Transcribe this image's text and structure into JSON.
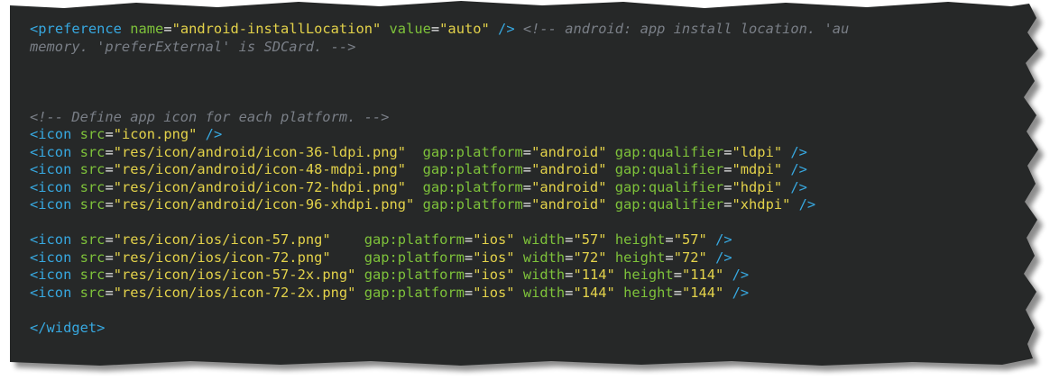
{
  "theme": {
    "background": "#262828",
    "tag": "#37a8e0",
    "attr": "#7ec23a",
    "string": "#e3d24a",
    "comment": "#7a7f87",
    "punct": "#3aa7e0"
  },
  "editor": {
    "lines": [
      [
        {
          "t": "<",
          "k": "tag"
        },
        {
          "t": "preference",
          "k": "tag"
        },
        {
          "t": " ",
          "k": "plain"
        },
        {
          "t": "name",
          "k": "attr"
        },
        {
          "t": "=",
          "k": "plain"
        },
        {
          "t": "\"android-installLocation\"",
          "k": "string"
        },
        {
          "t": " ",
          "k": "plain"
        },
        {
          "t": "value",
          "k": "attr"
        },
        {
          "t": "=",
          "k": "plain"
        },
        {
          "t": "\"auto\"",
          "k": "string"
        },
        {
          "t": " ",
          "k": "plain"
        },
        {
          "t": "/>",
          "k": "tag"
        },
        {
          "t": " ",
          "k": "plain"
        },
        {
          "t": "<!-- android: app install location. 'au",
          "k": "comment"
        }
      ],
      [
        {
          "t": "memory. 'preferExternal' is SDCard. -->",
          "k": "comment"
        }
      ],
      [],
      [],
      [],
      [
        {
          "t": "<!-- Define app icon for each platform. -->",
          "k": "comment"
        }
      ],
      [
        {
          "t": "<icon",
          "k": "tag"
        },
        {
          "t": " ",
          "k": "plain"
        },
        {
          "t": "src",
          "k": "attr"
        },
        {
          "t": "=",
          "k": "plain"
        },
        {
          "t": "\"icon.png\"",
          "k": "string"
        },
        {
          "t": " ",
          "k": "plain"
        },
        {
          "t": "/>",
          "k": "tag"
        }
      ],
      [
        {
          "t": "<icon",
          "k": "tag"
        },
        {
          "t": " ",
          "k": "plain"
        },
        {
          "t": "src",
          "k": "attr"
        },
        {
          "t": "=",
          "k": "plain"
        },
        {
          "t": "\"res/icon/android/icon-36-ldpi.png\"",
          "k": "string"
        },
        {
          "t": "  ",
          "k": "plain"
        },
        {
          "t": "gap:platform",
          "k": "attr"
        },
        {
          "t": "=",
          "k": "plain"
        },
        {
          "t": "\"android\"",
          "k": "string"
        },
        {
          "t": " ",
          "k": "plain"
        },
        {
          "t": "gap:qualifier",
          "k": "attr"
        },
        {
          "t": "=",
          "k": "plain"
        },
        {
          "t": "\"ldpi\"",
          "k": "string"
        },
        {
          "t": " ",
          "k": "plain"
        },
        {
          "t": "/>",
          "k": "tag"
        }
      ],
      [
        {
          "t": "<icon",
          "k": "tag"
        },
        {
          "t": " ",
          "k": "plain"
        },
        {
          "t": "src",
          "k": "attr"
        },
        {
          "t": "=",
          "k": "plain"
        },
        {
          "t": "\"res/icon/android/icon-48-mdpi.png\"",
          "k": "string"
        },
        {
          "t": "  ",
          "k": "plain"
        },
        {
          "t": "gap:platform",
          "k": "attr"
        },
        {
          "t": "=",
          "k": "plain"
        },
        {
          "t": "\"android\"",
          "k": "string"
        },
        {
          "t": " ",
          "k": "plain"
        },
        {
          "t": "gap:qualifier",
          "k": "attr"
        },
        {
          "t": "=",
          "k": "plain"
        },
        {
          "t": "\"mdpi\"",
          "k": "string"
        },
        {
          "t": " ",
          "k": "plain"
        },
        {
          "t": "/>",
          "k": "tag"
        }
      ],
      [
        {
          "t": "<icon",
          "k": "tag"
        },
        {
          "t": " ",
          "k": "plain"
        },
        {
          "t": "src",
          "k": "attr"
        },
        {
          "t": "=",
          "k": "plain"
        },
        {
          "t": "\"res/icon/android/icon-72-hdpi.png\"",
          "k": "string"
        },
        {
          "t": "  ",
          "k": "plain"
        },
        {
          "t": "gap:platform",
          "k": "attr"
        },
        {
          "t": "=",
          "k": "plain"
        },
        {
          "t": "\"android\"",
          "k": "string"
        },
        {
          "t": " ",
          "k": "plain"
        },
        {
          "t": "gap:qualifier",
          "k": "attr"
        },
        {
          "t": "=",
          "k": "plain"
        },
        {
          "t": "\"hdpi\"",
          "k": "string"
        },
        {
          "t": " ",
          "k": "plain"
        },
        {
          "t": "/>",
          "k": "tag"
        }
      ],
      [
        {
          "t": "<icon",
          "k": "tag"
        },
        {
          "t": " ",
          "k": "plain"
        },
        {
          "t": "src",
          "k": "attr"
        },
        {
          "t": "=",
          "k": "plain"
        },
        {
          "t": "\"res/icon/android/icon-96-xhdpi.png\"",
          "k": "string"
        },
        {
          "t": " ",
          "k": "plain"
        },
        {
          "t": "gap:platform",
          "k": "attr"
        },
        {
          "t": "=",
          "k": "plain"
        },
        {
          "t": "\"android\"",
          "k": "string"
        },
        {
          "t": " ",
          "k": "plain"
        },
        {
          "t": "gap:qualifier",
          "k": "attr"
        },
        {
          "t": "=",
          "k": "plain"
        },
        {
          "t": "\"xhdpi\"",
          "k": "string"
        },
        {
          "t": " ",
          "k": "plain"
        },
        {
          "t": "/>",
          "k": "tag"
        }
      ],
      [],
      [
        {
          "t": "<icon",
          "k": "tag"
        },
        {
          "t": " ",
          "k": "plain"
        },
        {
          "t": "src",
          "k": "attr"
        },
        {
          "t": "=",
          "k": "plain"
        },
        {
          "t": "\"res/icon/ios/icon-57.png\"",
          "k": "string"
        },
        {
          "t": "    ",
          "k": "plain"
        },
        {
          "t": "gap:platform",
          "k": "attr"
        },
        {
          "t": "=",
          "k": "plain"
        },
        {
          "t": "\"ios\"",
          "k": "string"
        },
        {
          "t": " ",
          "k": "plain"
        },
        {
          "t": "width",
          "k": "attr"
        },
        {
          "t": "=",
          "k": "plain"
        },
        {
          "t": "\"57\"",
          "k": "string"
        },
        {
          "t": " ",
          "k": "plain"
        },
        {
          "t": "height",
          "k": "attr"
        },
        {
          "t": "=",
          "k": "plain"
        },
        {
          "t": "\"57\"",
          "k": "string"
        },
        {
          "t": " ",
          "k": "plain"
        },
        {
          "t": "/>",
          "k": "tag"
        }
      ],
      [
        {
          "t": "<icon",
          "k": "tag"
        },
        {
          "t": " ",
          "k": "plain"
        },
        {
          "t": "src",
          "k": "attr"
        },
        {
          "t": "=",
          "k": "plain"
        },
        {
          "t": "\"res/icon/ios/icon-72.png\"",
          "k": "string"
        },
        {
          "t": "    ",
          "k": "plain"
        },
        {
          "t": "gap:platform",
          "k": "attr"
        },
        {
          "t": "=",
          "k": "plain"
        },
        {
          "t": "\"ios\"",
          "k": "string"
        },
        {
          "t": " ",
          "k": "plain"
        },
        {
          "t": "width",
          "k": "attr"
        },
        {
          "t": "=",
          "k": "plain"
        },
        {
          "t": "\"72\"",
          "k": "string"
        },
        {
          "t": " ",
          "k": "plain"
        },
        {
          "t": "height",
          "k": "attr"
        },
        {
          "t": "=",
          "k": "plain"
        },
        {
          "t": "\"72\"",
          "k": "string"
        },
        {
          "t": " ",
          "k": "plain"
        },
        {
          "t": "/>",
          "k": "tag"
        }
      ],
      [
        {
          "t": "<icon",
          "k": "tag"
        },
        {
          "t": " ",
          "k": "plain"
        },
        {
          "t": "src",
          "k": "attr"
        },
        {
          "t": "=",
          "k": "plain"
        },
        {
          "t": "\"res/icon/ios/icon-57-2x.png\"",
          "k": "string"
        },
        {
          "t": " ",
          "k": "plain"
        },
        {
          "t": "gap:platform",
          "k": "attr"
        },
        {
          "t": "=",
          "k": "plain"
        },
        {
          "t": "\"ios\"",
          "k": "string"
        },
        {
          "t": " ",
          "k": "plain"
        },
        {
          "t": "width",
          "k": "attr"
        },
        {
          "t": "=",
          "k": "plain"
        },
        {
          "t": "\"114\"",
          "k": "string"
        },
        {
          "t": " ",
          "k": "plain"
        },
        {
          "t": "height",
          "k": "attr"
        },
        {
          "t": "=",
          "k": "plain"
        },
        {
          "t": "\"114\"",
          "k": "string"
        },
        {
          "t": " ",
          "k": "plain"
        },
        {
          "t": "/>",
          "k": "tag"
        }
      ],
      [
        {
          "t": "<icon",
          "k": "tag"
        },
        {
          "t": " ",
          "k": "plain"
        },
        {
          "t": "src",
          "k": "attr"
        },
        {
          "t": "=",
          "k": "plain"
        },
        {
          "t": "\"res/icon/ios/icon-72-2x.png\"",
          "k": "string"
        },
        {
          "t": " ",
          "k": "plain"
        },
        {
          "t": "gap:platform",
          "k": "attr"
        },
        {
          "t": "=",
          "k": "plain"
        },
        {
          "t": "\"ios\"",
          "k": "string"
        },
        {
          "t": " ",
          "k": "plain"
        },
        {
          "t": "width",
          "k": "attr"
        },
        {
          "t": "=",
          "k": "plain"
        },
        {
          "t": "\"144\"",
          "k": "string"
        },
        {
          "t": " ",
          "k": "plain"
        },
        {
          "t": "height",
          "k": "attr"
        },
        {
          "t": "=",
          "k": "plain"
        },
        {
          "t": "\"144\"",
          "k": "string"
        },
        {
          "t": " ",
          "k": "plain"
        },
        {
          "t": "/>",
          "k": "tag"
        }
      ],
      [],
      [
        {
          "t": "</widget>",
          "k": "tag"
        }
      ]
    ]
  }
}
